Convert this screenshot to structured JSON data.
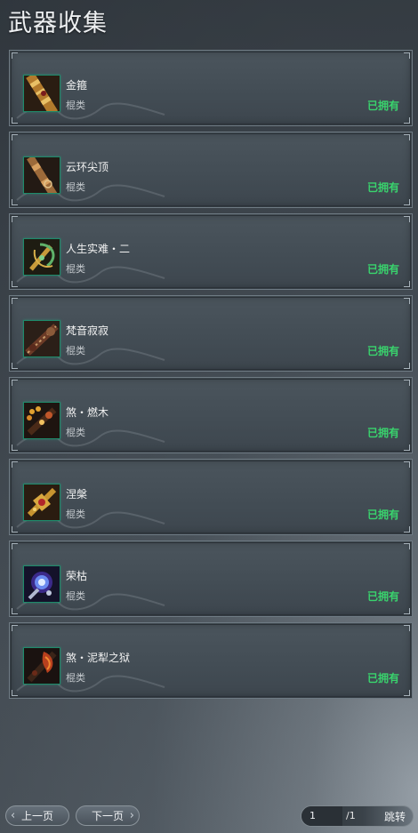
{
  "title": "武器收集",
  "colors": {
    "owned": "#39d36d",
    "icon_border": "#1e8a6a"
  },
  "items": [
    {
      "name": "金箍",
      "type": "棍类",
      "status": "已拥有",
      "icon": "golden-staff-icon"
    },
    {
      "name": "云环尖顶",
      "type": "棍类",
      "status": "已拥有",
      "icon": "bronze-ring-staff-icon"
    },
    {
      "name": "人生实难・二",
      "type": "棍类",
      "status": "已拥有",
      "icon": "jade-crescent-staff-icon"
    },
    {
      "name": "梵音寂寂",
      "type": "棍类",
      "status": "已拥有",
      "icon": "carved-bone-staff-icon"
    },
    {
      "name": "煞・燃木",
      "type": "棍类",
      "status": "已拥有",
      "icon": "burning-wood-staff-icon"
    },
    {
      "name": "涅槃",
      "type": "棍类",
      "status": "已拥有",
      "icon": "nirvana-staff-icon"
    },
    {
      "name": "荣枯",
      "type": "棍类",
      "status": "已拥有",
      "icon": "blue-orb-staff-icon"
    },
    {
      "name": "煞・泥犁之狱",
      "type": "棍类",
      "status": "已拥有",
      "icon": "hell-flame-staff-icon"
    }
  ],
  "footer": {
    "prev_label": "上一页",
    "next_label": "下一页",
    "page_current": "1",
    "page_total": "/1",
    "jump_label": "跳转"
  }
}
